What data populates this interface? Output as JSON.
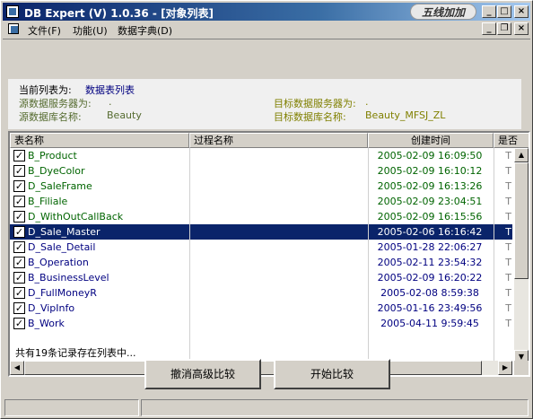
{
  "window": {
    "title": "DB Expert (V) 1.0.36 - [对象列表]",
    "logo_text": "五线加加",
    "minimize": "_",
    "maximize": "□",
    "close": "×"
  },
  "menu": {
    "items": [
      "文件(F)",
      "功能(U)",
      "数据字典(D)"
    ],
    "mdi_minimize": "_",
    "mdi_restore": "❐",
    "mdi_close": "×"
  },
  "info": {
    "current_list_label": "当前列表为:",
    "current_list_value": "数据表列表",
    "source_server_label": "源数据服务器为:",
    "source_server_value": ".",
    "source_db_label": "源数据库名称:",
    "source_db_value": "Beauty",
    "target_server_label": "目标数据服务器为:",
    "target_server_value": ".",
    "target_db_label": "目标数据库名称:",
    "target_db_value": "Beauty_MFSJ_ZL"
  },
  "list": {
    "columns": [
      "表名称",
      "过程名称",
      "创建时间",
      "是否"
    ],
    "rows": [
      {
        "name": "B_Product",
        "proc": "",
        "created": "2005-02-09 16:09:50",
        "flag": "T",
        "checked": true,
        "color": "#006400",
        "selected": false
      },
      {
        "name": "B_DyeColor",
        "proc": "",
        "created": "2005-02-09 16:10:12",
        "flag": "T",
        "checked": true,
        "color": "#006400",
        "selected": false
      },
      {
        "name": "D_SaleFrame",
        "proc": "",
        "created": "2005-02-09 16:13:26",
        "flag": "T",
        "checked": true,
        "color": "#006400",
        "selected": false
      },
      {
        "name": "B_Filiale",
        "proc": "",
        "created": "2005-02-09 23:04:51",
        "flag": "T",
        "checked": true,
        "color": "#006400",
        "selected": false
      },
      {
        "name": "D_WithOutCallBack",
        "proc": "",
        "created": "2005-02-09 16:15:56",
        "flag": "T",
        "checked": true,
        "color": "#006400",
        "selected": false
      },
      {
        "name": "D_Sale_Master",
        "proc": "",
        "created": "2005-02-06 16:16:42",
        "flag": "T",
        "checked": true,
        "color": "#ffffff",
        "selected": true
      },
      {
        "name": "D_Sale_Detail",
        "proc": "",
        "created": "2005-01-28 22:06:27",
        "flag": "T",
        "checked": true,
        "color": "#000080",
        "selected": false
      },
      {
        "name": "B_Operation",
        "proc": "",
        "created": "2005-02-11 23:54:32",
        "flag": "T",
        "checked": true,
        "color": "#000080",
        "selected": false
      },
      {
        "name": "B_BusinessLevel",
        "proc": "",
        "created": "2005-02-09 16:20:22",
        "flag": "T",
        "checked": true,
        "color": "#000080",
        "selected": false
      },
      {
        "name": "D_FullMoneyR",
        "proc": "",
        "created": "2005-02-08 8:59:38",
        "flag": "T",
        "checked": true,
        "color": "#000080",
        "selected": false
      },
      {
        "name": "D_VipInfo",
        "proc": "",
        "created": "2005-01-16 23:49:56",
        "flag": "T",
        "checked": true,
        "color": "#000080",
        "selected": false
      },
      {
        "name": "B_Work",
        "proc": "",
        "created": "2005-04-11 9:59:45",
        "flag": "T",
        "checked": true,
        "color": "#000080",
        "selected": false
      }
    ]
  },
  "footer": {
    "count_text": "共有19条记录存在列表中...",
    "cancel_button": "撤消高级比较",
    "start_button": "开始比较"
  }
}
